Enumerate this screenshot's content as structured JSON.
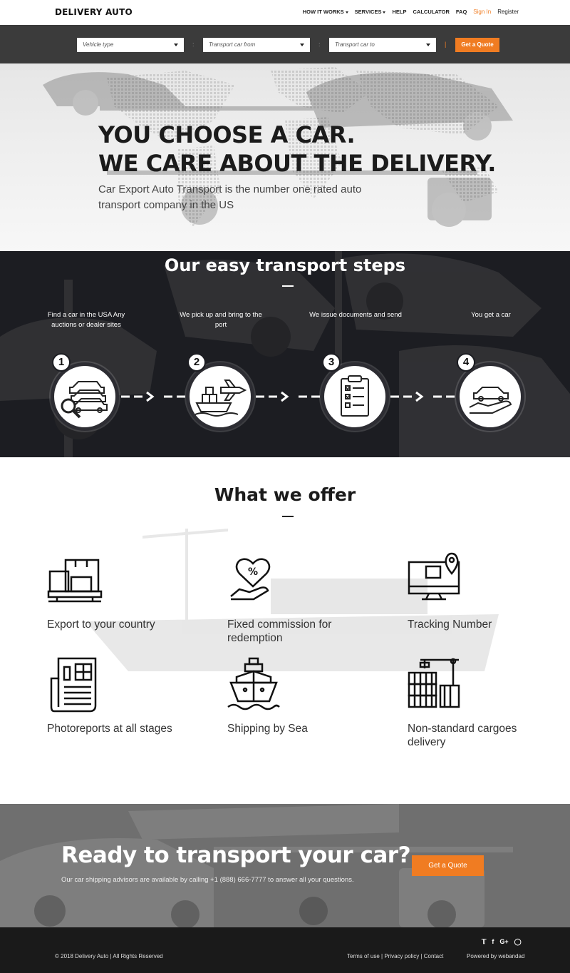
{
  "header": {
    "logo": "DELIVERY AUTO",
    "menu": {
      "how_it_works": "HOW IT WORKS",
      "services": "SERVICES",
      "help": "HELP",
      "calculator": "CALCULATOR",
      "faq": "FAQ",
      "sign_in": "Sign In",
      "register": "Register"
    }
  },
  "search": {
    "vehicle_type": "Vehicle type",
    "from": "Transport car from",
    "to": "Transport car to",
    "separator": ":",
    "quote_button": "Get a Quote"
  },
  "hero": {
    "title_line1": "YOU CHOOSE A CAR.",
    "title_line2": "WE CARE ABOUT THE DELIVERY.",
    "subtitle": "Car Export Auto Transport is the number one rated auto transport company in the US"
  },
  "steps": {
    "title": "Our easy transport steps",
    "items": [
      {
        "number": "1",
        "label": "Find a car in the USA Any auctions or dealer sites",
        "icon": "car-search-icon"
      },
      {
        "number": "2",
        "label": "We pick up and bring to the port",
        "icon": "ship-plane-icon"
      },
      {
        "number": "3",
        "label": "We issue documents and send",
        "icon": "clipboard-checklist-icon"
      },
      {
        "number": "4",
        "label": "You get a car",
        "icon": "car-in-hand-icon"
      }
    ]
  },
  "offer": {
    "title": "What we offer",
    "items": [
      {
        "label": "Export to your country",
        "icon": "boxes-pallet-icon"
      },
      {
        "label": "Fixed commission for redemption",
        "icon": "heart-percent-hand-icon"
      },
      {
        "label": "Tracking Number",
        "icon": "monitor-location-icon"
      },
      {
        "label": "Photoreports at all stages",
        "icon": "newspaper-icon"
      },
      {
        "label": "Shipping by Sea",
        "icon": "ship-icon"
      },
      {
        "label": "Non-standard cargoes delivery",
        "icon": "crane-containers-icon"
      }
    ]
  },
  "cta": {
    "title": "Ready to transport your car?",
    "text": "Our car shipping advisors are available by calling +1 (888) 666-7777 to answer all your questions.",
    "button": "Get a Quote"
  },
  "footer": {
    "copyright": "© 2018 Delivery Auto |  All Rights Reserved",
    "terms": "Terms of use",
    "privacy": "Privacy policy",
    "contact": "Contact",
    "link_sep": " | ",
    "powered": "Powered by webandad",
    "social": [
      "twitter-icon",
      "facebook-icon",
      "google-plus-icon",
      "instagram-icon"
    ]
  },
  "colors": {
    "accent": "#f07c22",
    "dark_bar": "#3b3b3b",
    "footer": "#1a1a1a"
  }
}
